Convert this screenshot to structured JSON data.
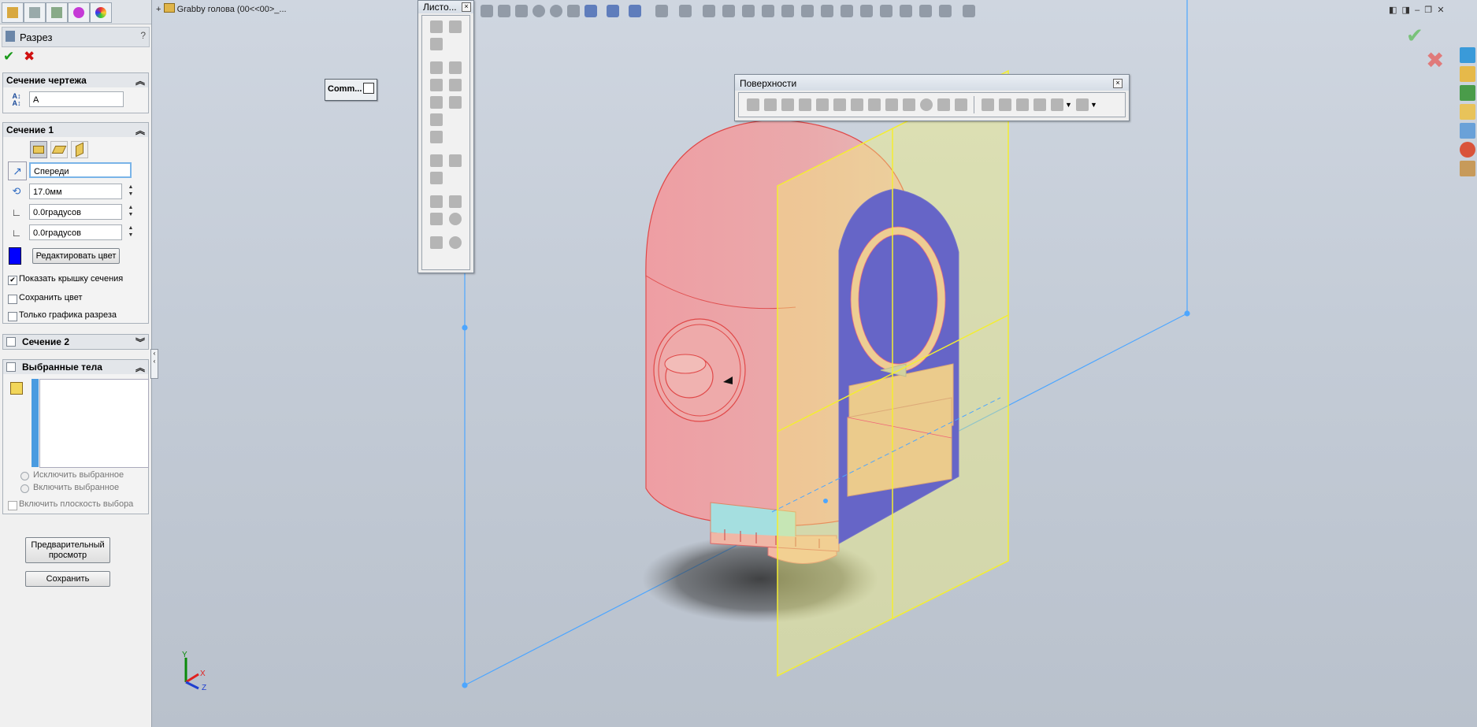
{
  "property_manager": {
    "title": "Разрез",
    "help": "?",
    "ok_icon": "checkmark-icon",
    "cancel_icon": "x-icon",
    "drawing_section": {
      "header": "Сечение чертежа",
      "label_value": "A"
    },
    "section1": {
      "header": "Сечение 1",
      "plane": "Спереди",
      "offset": "17.0мм",
      "angle_x": "0.0градусов",
      "angle_y": "0.0градусов",
      "edit_color_button": "Редактировать цвет",
      "section_color": "#0000ff",
      "show_cap": {
        "label": "Показать крышку сечения",
        "checked": true
      },
      "keep_color": {
        "label": "Сохранить цвет",
        "checked": false
      },
      "graphics_only": {
        "label": "Только графика разреза",
        "checked": false
      }
    },
    "section2": {
      "header": "Сечение 2"
    },
    "selected_bodies": {
      "header": "Выбранные тела",
      "exclude_label": "Исключить выбранное",
      "include_label": "Включить выбранное",
      "include_plane_label": "Включить плоскость выбора"
    },
    "preview_button": "Предварительный просмотр",
    "save_button": "Сохранить"
  },
  "tree": {
    "item_label": "Grabby голова  (00<<00>_..."
  },
  "command_tab": "Comm...",
  "sheet_toolbar": {
    "title": "Листо..."
  },
  "surfaces_toolbar": {
    "title": "Поверхности"
  },
  "colors": {
    "section_blue": "#0000ff",
    "plane_yellow": "#f4f07a",
    "model_pink": "#eba5a8",
    "bbox_blue": "#4da6ff"
  }
}
